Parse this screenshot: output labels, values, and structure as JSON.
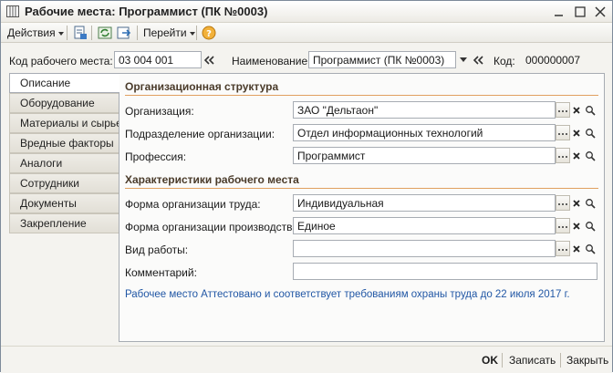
{
  "window": {
    "title": "Рабочие места: Программист (ПК №0003)"
  },
  "toolbar": {
    "actions_label": "Действия",
    "goto_label": "Перейти"
  },
  "header": {
    "code_label": "Код рабочего места:",
    "code_value": "03 004 001",
    "name_label": "Наименование:",
    "name_value": "Программист (ПК №0003)",
    "id_label": "Код:",
    "id_value": "000000007"
  },
  "tabs": [
    {
      "label": "Описание"
    },
    {
      "label": "Оборудование"
    },
    {
      "label": "Материалы и сырье"
    },
    {
      "label": "Вредные факторы"
    },
    {
      "label": "Аналоги"
    },
    {
      "label": "Сотрудники"
    },
    {
      "label": "Документы"
    },
    {
      "label": "Закрепление"
    }
  ],
  "org_section": {
    "title": "Организационная структура",
    "organization_label": "Организация:",
    "organization_value": "ЗАО \"Дельтаон\"",
    "department_label": "Подразделение организации:",
    "department_value": "Отдел информационных технологий",
    "profession_label": "Профессия:",
    "profession_value": "Программист"
  },
  "char_section": {
    "title": "Характеристики рабочего места",
    "labor_form_label": "Форма организации труда:",
    "labor_form_value": "Индивидуальная",
    "production_form_label": "Форма организации производства:",
    "production_form_value": "Единое",
    "work_type_label": "Вид работы:",
    "work_type_value": "",
    "comment_label": "Комментарий:",
    "comment_value": ""
  },
  "note": "Рабочее место Аттестовано и соответствует требованиям охраны труда до 22 июля 2017 г.",
  "footer": {
    "ok_label": "OK",
    "save_label": "Записать",
    "close_label": "Закрыть"
  },
  "colors": {
    "accent_orange": "#e0a060",
    "link_blue": "#2157a5",
    "section_title": "#4a3b2a"
  }
}
